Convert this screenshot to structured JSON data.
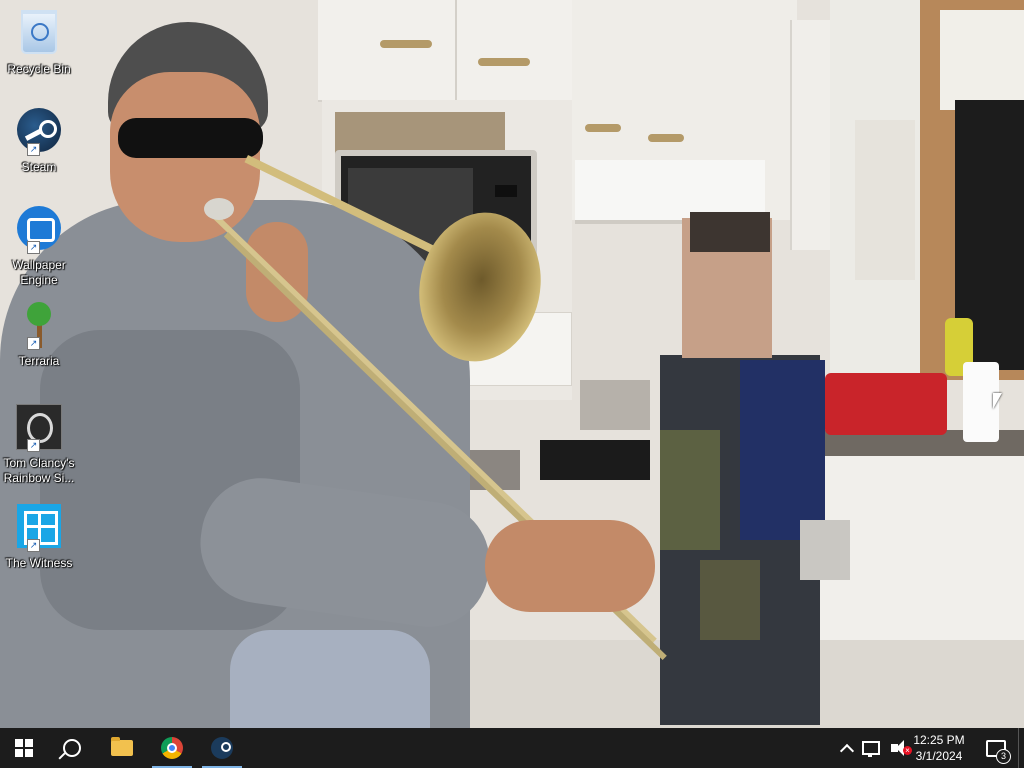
{
  "desktop": {
    "icons": [
      {
        "label": "Recycle Bin",
        "icon": "recycle-bin-icon"
      },
      {
        "label": "Steam",
        "icon": "steam-icon"
      },
      {
        "label": "Wallpaper Engine",
        "icon": "wallpaper-engine-icon"
      },
      {
        "label": "Terraria",
        "icon": "terraria-icon"
      },
      {
        "label": "Tom Clancy's Rainbow Si...",
        "icon": "rainbow-six-icon"
      },
      {
        "label": "The Witness",
        "icon": "the-witness-icon"
      }
    ],
    "wallpaper": "photo of a man in sunglasses playing a trombone in a kitchen"
  },
  "taskbar": {
    "pinned": [
      {
        "name": "Start",
        "icon": "windows-icon"
      },
      {
        "name": "Search",
        "icon": "search-icon"
      },
      {
        "name": "File Explorer",
        "icon": "folder-icon"
      },
      {
        "name": "Google Chrome",
        "icon": "chrome-icon",
        "active": true
      },
      {
        "name": "Steam",
        "icon": "steam-icon",
        "active": true
      }
    ],
    "tray": {
      "time": "12:25 PM",
      "date": "3/1/2024",
      "notification_count": "3"
    }
  },
  "colors": {
    "taskbar_bg": "#1c1c1c",
    "active_indicator": "#7fb4e6"
  }
}
